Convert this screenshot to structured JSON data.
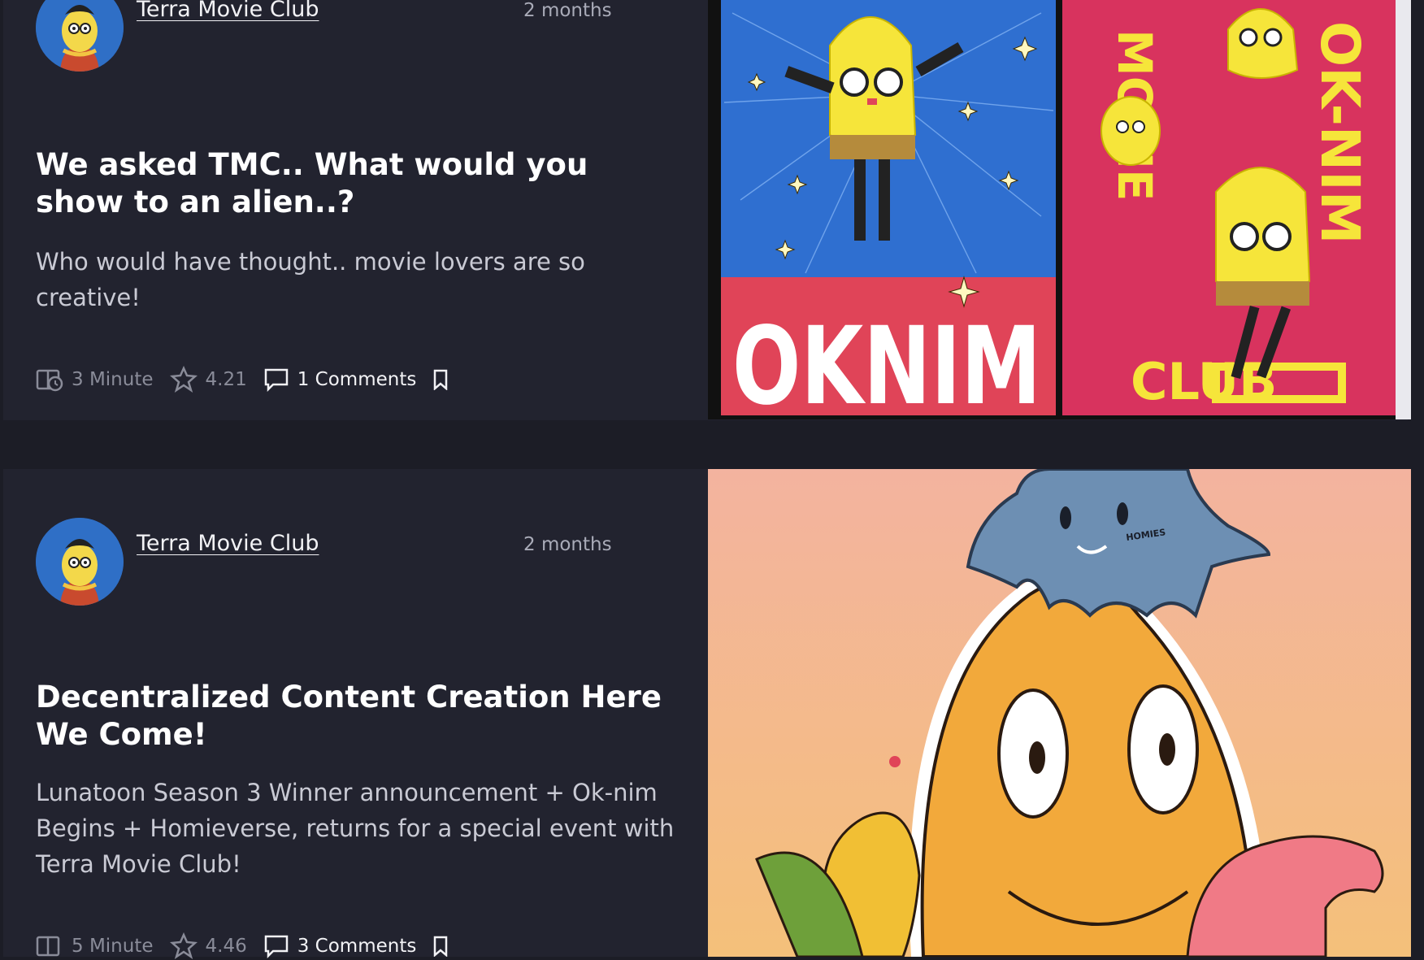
{
  "posts": [
    {
      "author": "Terra Movie Club",
      "time": "2 months",
      "title": "We asked TMC.. What would you show to an alien..?",
      "description": "Who would have thought.. movie lovers are so creative!",
      "read_time": "3 Minute",
      "rating": "4.21",
      "comments": "1 Comments",
      "image_text_left": "OKNIM",
      "image_text_right": "OK-NIM",
      "image_text_vertical": "MOVIE",
      "image_text_club": "CLUB"
    },
    {
      "author": "Terra Movie Club",
      "time": "2 months",
      "title": "Decentralized Content Creation Here We Come!",
      "description": "Lunatoon Season 3 Winner announcement + Ok-nim Begins  + Homieverse, returns for a special event with Terra Movie Club!",
      "read_time": "5 Minute",
      "rating": "4.46",
      "comments": "3 Comments",
      "image_text": "HOMIES"
    }
  ],
  "icons": {
    "read_time": "clock-book-icon",
    "rating": "star-icon",
    "comments": "comment-icon",
    "bookmark": "bookmark-icon"
  },
  "colors": {
    "background": "#1c1d26",
    "card": "#22232f",
    "poster_blue": "#2f6fd0",
    "poster_red": "#e04458",
    "poster_pink": "#d8335e",
    "character_yellow": "#f6e53a",
    "peach_bg": "#f3b89a",
    "orange_character": "#f2a93b"
  }
}
